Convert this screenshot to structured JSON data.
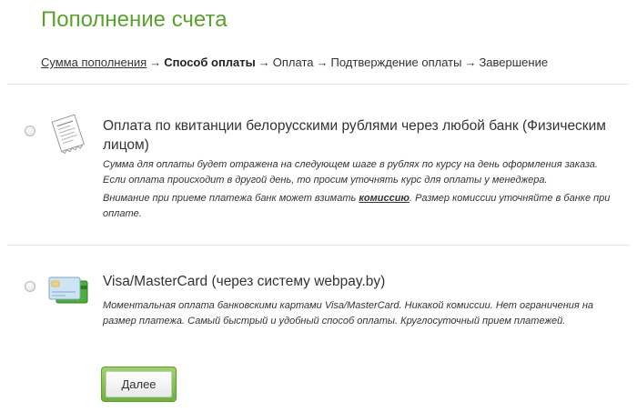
{
  "page": {
    "title": "Пополнение счета"
  },
  "breadcrumb": {
    "steps": [
      {
        "label": "Сумма пополнения",
        "state": "done"
      },
      {
        "label": "Способ оплаты",
        "state": "current"
      },
      {
        "label": "Оплата",
        "state": "pending"
      },
      {
        "label": "Подтверждение оплаты",
        "state": "pending"
      },
      {
        "label": "Завершение",
        "state": "pending"
      }
    ],
    "separator": "→"
  },
  "options": [
    {
      "icon": "receipt-icon",
      "selected": false,
      "title": "Оплата по квитанции белорусскими рублями через любой банк (Физическим лицом)",
      "desc1": "Сумма для оплаты будет отражена на следующем шаге в рублях по курсу на день оформления заказа. Если оплата происходит в другой день, то просим уточнять курс для оплаты у менеджера.",
      "desc2_pre": "Внимание при приеме платежа банк может взимать ",
      "desc2_bold": "комиссию",
      "desc2_post": ". Размер комиссии уточняйте в банке при оплате."
    },
    {
      "icon": "credit-cards-icon",
      "selected": false,
      "title": "Visa/MasterCard (через систему webpay.by)",
      "desc1": "Моментальная оплата банковскими картами Visa/MasterCard. Никакой комиссии. Нет ограничения на размер платежа. Самый быстрый и удобный способ оплаты. Круглосуточный прием платежей."
    }
  ],
  "actions": {
    "next_label": "Далее"
  },
  "colors": {
    "title_green": "#5aa32a",
    "button_green": "#6db33c"
  }
}
